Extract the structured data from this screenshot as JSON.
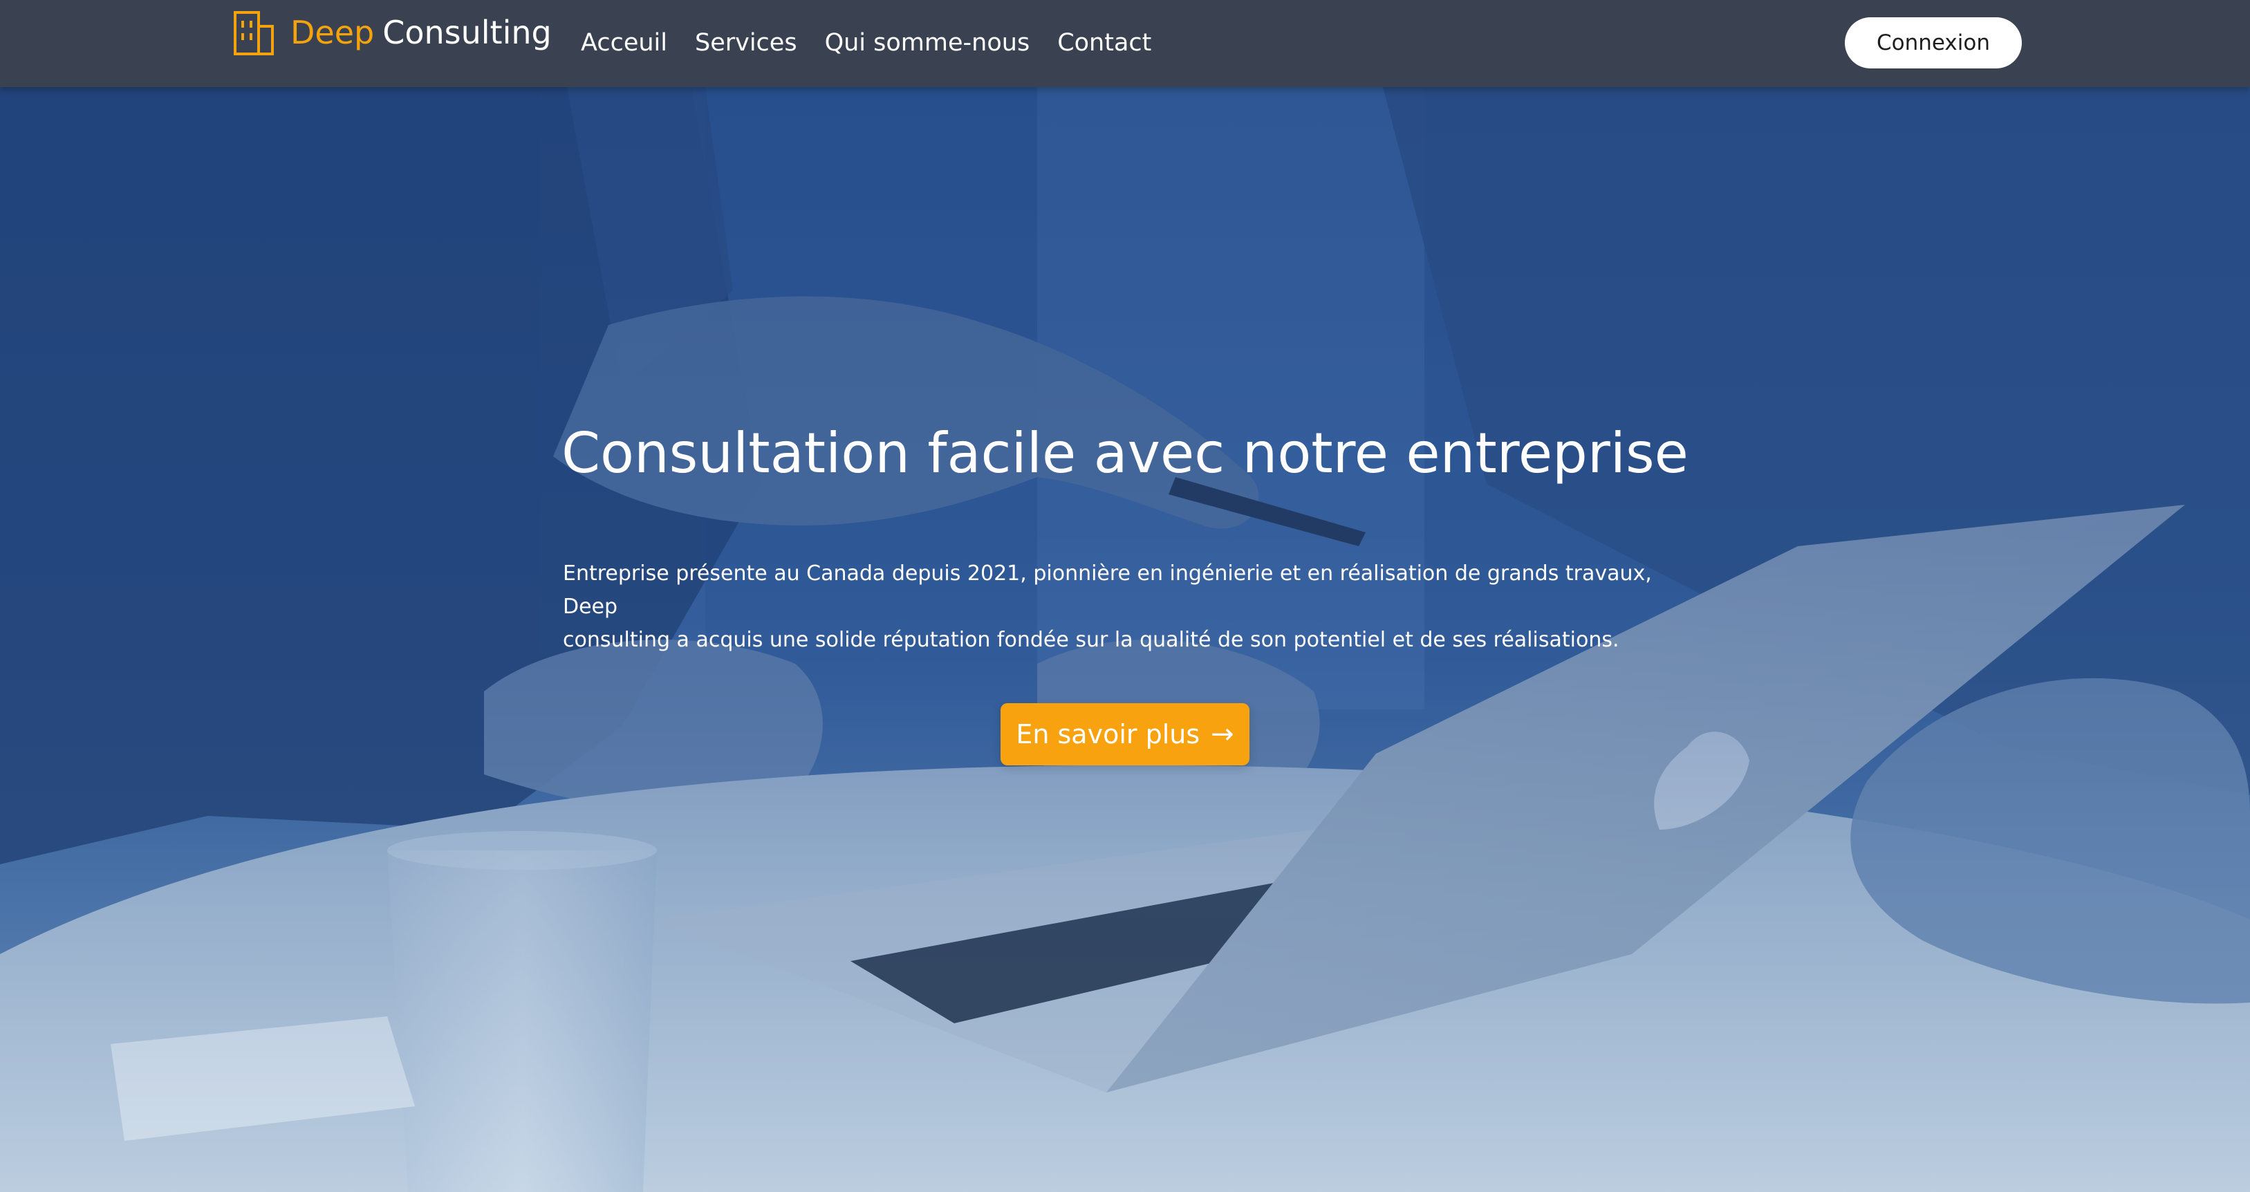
{
  "brand": {
    "name_part1": "Deep",
    "name_part2": "Consulting",
    "icon": "building-icon",
    "accent_color": "#f5a30d"
  },
  "nav": {
    "items": [
      {
        "label": "Acceuil"
      },
      {
        "label": "Services"
      },
      {
        "label": "Qui somme-nous"
      },
      {
        "label": "Contact"
      }
    ],
    "login_label": "Connexion",
    "bar_color": "#3a4252"
  },
  "hero": {
    "title": "Consultation facile avec notre entreprise",
    "description_line1": "Entreprise présente au Canada depuis 2021, pionnière en ingénierie et en réalisation de grands travaux, Deep",
    "description_line2": "consulting a acquis une solide réputation fondée sur la qualité de son potentiel et de ses réalisations.",
    "cta_label": "En savoir plus",
    "cta_icon": "arrow-right-icon",
    "cta_color": "#f8a20f",
    "background": "business-meeting-laptop-photo"
  }
}
